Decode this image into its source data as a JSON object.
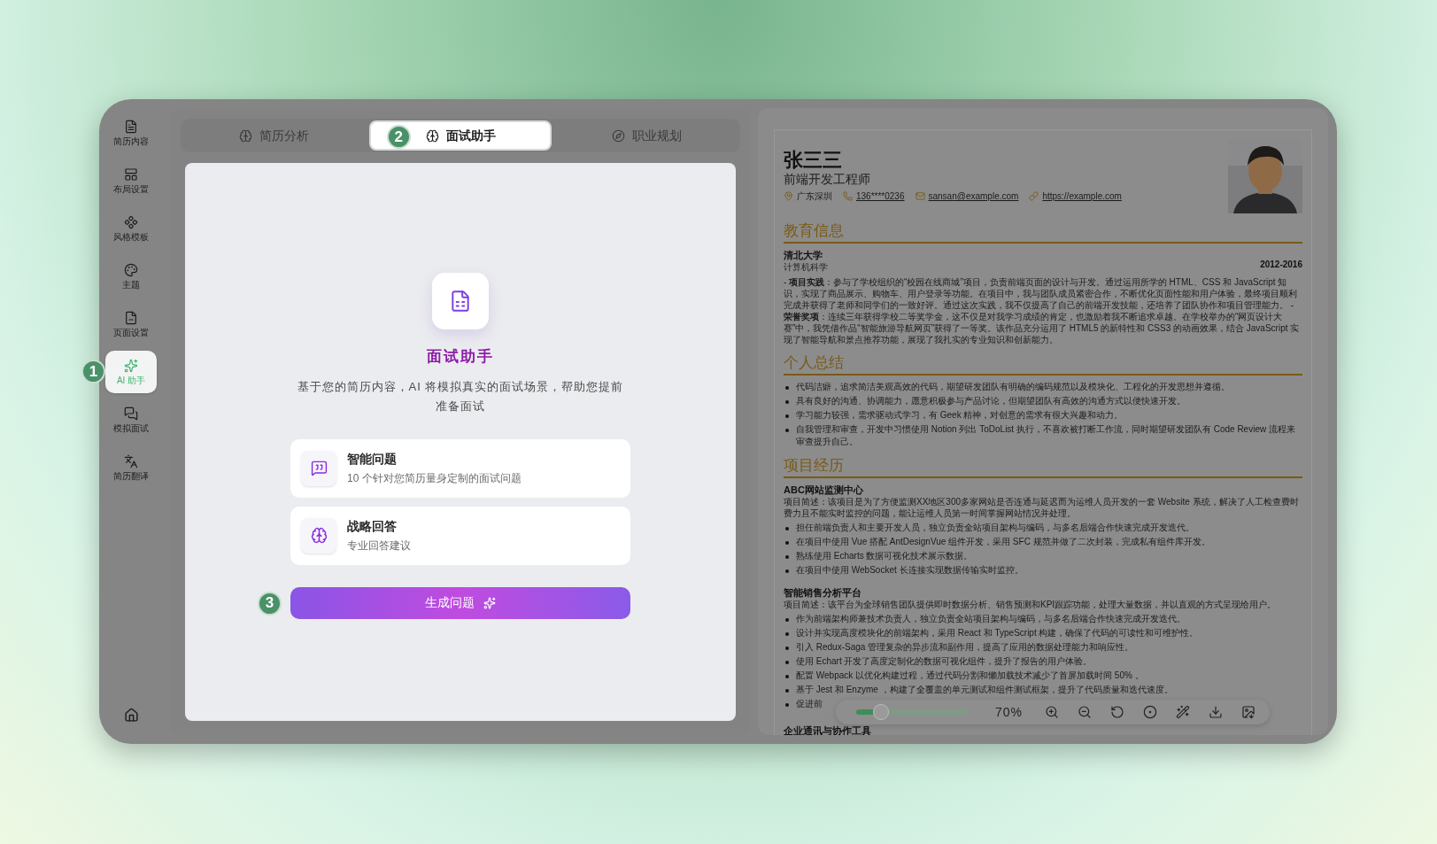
{
  "sidebar": {
    "items": [
      {
        "label": "简历内容",
        "selected": false
      },
      {
        "label": "布局设置",
        "selected": false
      },
      {
        "label": "风格模板",
        "selected": false
      },
      {
        "label": "主题",
        "selected": false
      },
      {
        "label": "页面设置",
        "selected": false
      },
      {
        "label": "AI 助手",
        "selected": true,
        "badge": "1"
      },
      {
        "label": "模拟面试",
        "selected": false
      },
      {
        "label": "简历翻译",
        "selected": false
      }
    ]
  },
  "tabs": [
    {
      "label": "简历分析",
      "selected": false
    },
    {
      "label": "面试助手",
      "selected": true,
      "badge": "2"
    },
    {
      "label": "职业规划",
      "selected": false
    }
  ],
  "assistant": {
    "title": "面试助手",
    "description": "基于您的简历内容，AI 将模拟真实的面试场景，帮助您提前准备面试",
    "features": [
      {
        "title": "智能问题",
        "subtitle": "10 个针对您简历量身定制的面试问题"
      },
      {
        "title": "战略回答",
        "subtitle": "专业回答建议"
      }
    ],
    "button": {
      "label": "生成问题",
      "badge": "3"
    }
  },
  "resume": {
    "name": "张三三",
    "title": "前端开发工程师",
    "contacts": [
      {
        "text": "广东深圳",
        "link": false
      },
      {
        "text": "136****0236",
        "link": true
      },
      {
        "text": "sansan@example.com",
        "link": true
      },
      {
        "text": "https://example.com",
        "link": true
      }
    ],
    "sections": [
      {
        "kind": "education",
        "heading": "教育信息",
        "school": "清北大学",
        "major": "计算机科学",
        "period": "2012-2016",
        "text": "- **项目实践**：参与了学校组织的“校园在线商城”项目，负责前端页面的设计与开发。通过运用所学的 HTML、CSS 和 JavaScript 知识，实现了商品展示、购物车、用户登录等功能。在项目中，我与团队成员紧密合作，不断优化页面性能和用户体验，最终项目顺利完成并获得了老师和同学们的一致好评。通过这次实践，我不仅提高了自己的前端开发技能，还培养了团队协作和项目管理能力。 - **荣誉奖项**：连续三年获得学校二等奖学金，这不仅是对我学习成绩的肯定，也激励着我不断追求卓越。在学校举办的“网页设计大赛”中，我凭借作品“智能旅游导航网页”获得了一等奖。该作品充分运用了 HTML5 的新特性和 CSS3 的动画效果，结合 JavaScript 实现了智能导航和景点推荐功能，展现了我扎实的专业知识和创新能力。"
      },
      {
        "kind": "bullets",
        "heading": "个人总结",
        "bullets": [
          "代码洁癖，追求简洁美观高效的代码，期望研发团队有明确的编码规范以及模块化、工程化的开发思想并遵循。",
          "具有良好的沟通、协调能力，愿意积极参与产品讨论，但期望团队有高效的沟通方式以便快速开发。",
          "学习能力较强，需求驱动式学习，有 Geek 精神，对创意的需求有很大兴趣和动力。",
          "自我管理和审查，开发中习惯使用 Notion 列出 ToDoList 执行，不喜欢被打断工作流，同时期望研发团队有 Code Review 流程来审查提升自己。"
        ]
      },
      {
        "kind": "projects",
        "heading": "项目经历",
        "projects": [
          {
            "name": "ABC网站监测中心",
            "description": "项目简述：该项目是为了方便监测XX地区300多家网站是否连通与延迟而为运维人员开发的一套 Website 系统，解决了人工检查费时费力且不能实时监控的问题，能让运维人员第一时间掌握网站情况并处理。",
            "bullets": [
              "担任前端负责人和主要开发人员，独立负责全站项目架构与编码，与多名后端合作快速完成开发迭代。",
              "在项目中使用 Vue 搭配 AntDesignVue 组件开发，采用 SFC 规范并做了二次封装，完成私有组件库开发。",
              "熟练使用 Echarts 数据可视化技术展示数据。",
              "在项目中使用 WebSocket 长连接实现数据传输实时监控。"
            ]
          },
          {
            "name": "智能销售分析平台",
            "description": "项目简述：该平台为全球销售团队提供即时数据分析、销售预测和KPI跟踪功能，处理大量数据，并以直观的方式呈现给用户。",
            "bullets": [
              "作为前端架构师兼技术负责人，独立负责全站项目架构与编码，与多名后端合作快速完成开发迭代。",
              "设计并实现高度模块化的前端架构，采用 React 和 TypeScript 构建，确保了代码的可读性和可维护性。",
              "引入 Redux-Saga 管理复杂的异步流和副作用，提高了应用的数据处理能力和响应性。",
              "使用 Echart 开发了高度定制化的数据可视化组件，提升了报告的用户体验。",
              "配置 Webpack 以优化构建过程，通过代码分割和懒加载技术减少了首屏加载时间 50% 。",
              "基于 Jest 和 Enzyme ，构建了全覆盖的单元测试和组件测试框架，提升了代码质量和迭代速度。",
              "促进前"
            ]
          },
          {
            "name": "企业通讯与协作工具"
          }
        ]
      }
    ]
  },
  "toolbar": {
    "zoom": {
      "level": 0.22,
      "reading": "70%"
    }
  }
}
